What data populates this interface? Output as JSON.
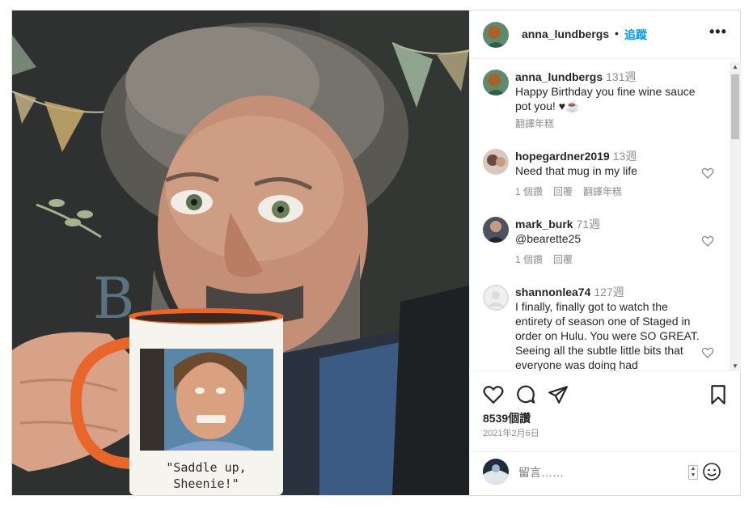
{
  "post": {
    "username": "anna_lundbergs",
    "dot": "•",
    "follow_label": "追蹤",
    "more_label": "•••"
  },
  "photo": {
    "mug_caption_line1": "\"Saddle up,",
    "mug_caption_line2": "Sheenie!\""
  },
  "comments": [
    {
      "username": "anna_lundbergs",
      "time": "131週",
      "text": "Happy Birthday you fine wine sauce pot you! ♥☕",
      "meta": [
        "翻譯年糕"
      ]
    },
    {
      "username": "hopegardner2019",
      "time": "13週",
      "text": "Need that mug in my life",
      "meta": [
        "1 個讚",
        "回覆",
        "翻譯年糕"
      ]
    },
    {
      "username": "mark_burk",
      "time": "71週",
      "text": "@bearette25",
      "meta": [
        "1 個讚",
        "回覆"
      ]
    },
    {
      "username": "shannonlea74",
      "time": "127週",
      "text": "I finally, finally got to watch the entirety of season one of Staged in order on Hulu. You were SO GREAT. Seeing all the subtle little bits that everyone was doing had",
      "meta": []
    }
  ],
  "actions": {
    "likes": "8539個讚",
    "date": "2021年2月6日"
  },
  "add_comment": {
    "placeholder": "留言……"
  },
  "icons": {
    "heart": "heart-icon",
    "comment": "comment-icon",
    "share": "share-icon",
    "save": "bookmark-icon",
    "emoji": "emoji-icon"
  },
  "colors": {
    "accent": "#0095f6",
    "text": "#262626",
    "muted": "#8e8e8e"
  }
}
